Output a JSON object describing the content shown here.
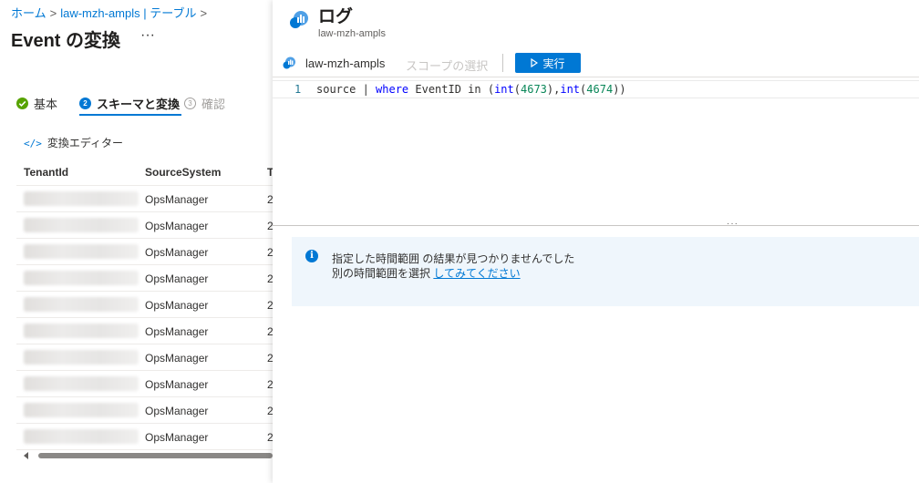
{
  "breadcrumb": {
    "home": "ホーム",
    "sep1": ">",
    "table": "law-mzh-ampls | テーブル",
    "sep2": ">"
  },
  "page": {
    "title": "Event の変換",
    "more": "···"
  },
  "steps": [
    {
      "label": "基本",
      "state": "done"
    },
    {
      "number": "2",
      "label": "スキーマと変換",
      "state": "active"
    },
    {
      "number": "3",
      "label": "確認",
      "state": "disabled"
    }
  ],
  "transform_editor_label": "変換エディター",
  "transform_editor_glyph": "</>",
  "grid": {
    "columns": [
      "TenantId",
      "SourceSystem",
      "T"
    ],
    "rows": [
      {
        "source": "OpsManager",
        "third": "2"
      },
      {
        "source": "OpsManager",
        "third": "2"
      },
      {
        "source": "OpsManager",
        "third": "2"
      },
      {
        "source": "OpsManager",
        "third": "2"
      },
      {
        "source": "OpsManager",
        "third": "2"
      },
      {
        "source": "OpsManager",
        "third": "2"
      },
      {
        "source": "OpsManager",
        "third": "2"
      },
      {
        "source": "OpsManager",
        "third": "2"
      },
      {
        "source": "OpsManager",
        "third": "2"
      },
      {
        "source": "OpsManager",
        "third": "2"
      }
    ]
  },
  "panel": {
    "title": "ログ",
    "subtitle": "law-mzh-ampls",
    "workspace": "law-mzh-ampls",
    "scope": "スコープの選択",
    "run": "実行"
  },
  "query": {
    "line_number": "1",
    "t1": "source ",
    "t2": "| ",
    "t3": "where",
    "t4": " EventID in (",
    "t5": "int",
    "t6": "(",
    "t7": "4673",
    "t8": "),",
    "t9": "int",
    "t10": "(",
    "t11": "4674",
    "t12": "))"
  },
  "splitter_grip": "···",
  "message": {
    "line1": "指定した時間範囲 の結果が見つかりませんでした",
    "line2_prefix": "別の時間範囲を選択 ",
    "line2_link": "してみてください"
  },
  "colors": {
    "accent": "#0078d4",
    "success": "#57a300",
    "info_bg": "#eff6fc"
  }
}
